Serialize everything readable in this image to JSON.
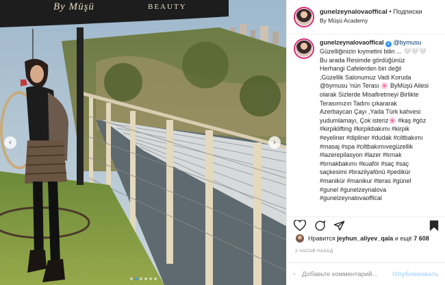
{
  "photo": {
    "awning_logo": "By Müşü",
    "awning_beauty": "BEAUTY",
    "prev_icon": "‹",
    "next_icon": "›",
    "dots_total": 6,
    "dots_active": 1
  },
  "header": {
    "username": "gunelzeynalovaoffical",
    "separator": "•",
    "follow": "Подписки",
    "location": "By Müşü Academy"
  },
  "caption": {
    "username": "gunelzeynalovaoffical",
    "mention": "@bymusu",
    "lines": [
      "Güzelliğinizin kıymetini bilin ... 🤍🤍🤍",
      "Bu arada Resimde gördüğünüz",
      "Herhangi Cafelerden biri değil",
      ",Güzellik Salonumuz Vadi Koruda",
      "@bymusu 'nün Terası 🌸 ByMüşü Ailesi",
      "olarak Sizlerde Misafiretmeyi Birlikte",
      "Terasımızın Tadını çıkararak",
      "Azerbaycan Çayı ,Yada Türk kahvesi",
      "yudumlamayı, Çok isteriz🌸 #kaş #göz",
      "#kirpiklifting #kirpikbakımı #kirpik",
      "#eyeliner #dipliner #dudak #ciltbakımı",
      "#masaj #spa #ciltbakımıvegüzellik",
      "#lazerepilasyon #lazer #tırnak",
      "#tırnakbakımı #kuaför #saç #saç",
      "saçkesimi #brazilyafönü #pedikür",
      "#manikür #manikur #teras #günel",
      "#gunel #gunelzeynalova",
      "#gunelzeynalovaoffical"
    ]
  },
  "likes": {
    "prefix": "Нравится",
    "user": "jeyhun_aliyev_qala",
    "middle": "и ещё",
    "count": "7 608"
  },
  "time_ago": "2 ЧАСОВ НАЗАД",
  "comment": {
    "placeholder": "Добавьте комментарий...",
    "publish": "Опубликовать"
  },
  "icons": {
    "like": "heart-icon",
    "comment": "comment-icon",
    "share": "share-icon",
    "save": "bookmark-icon",
    "emoji": "emoji-icon"
  }
}
